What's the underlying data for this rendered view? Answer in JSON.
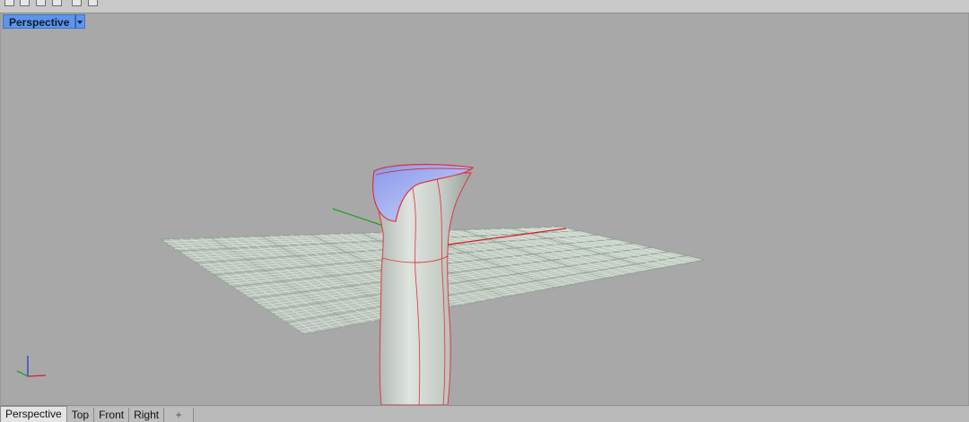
{
  "viewport": {
    "title": "Perspective",
    "axes": {
      "x_color": "#d02020",
      "y_color": "#20a020",
      "z_color": "#2040c0"
    },
    "grid_color": "#d9e6dc",
    "model_colors": {
      "surface": "#c9cfc9",
      "top_face": "#9aa8ee",
      "edge": "#e0303a"
    }
  },
  "tabs": [
    {
      "label": "Perspective",
      "active": true
    },
    {
      "label": "Top",
      "active": false
    },
    {
      "label": "Front",
      "active": false
    },
    {
      "label": "Right",
      "active": false
    }
  ],
  "add_tab_glyph": "+"
}
